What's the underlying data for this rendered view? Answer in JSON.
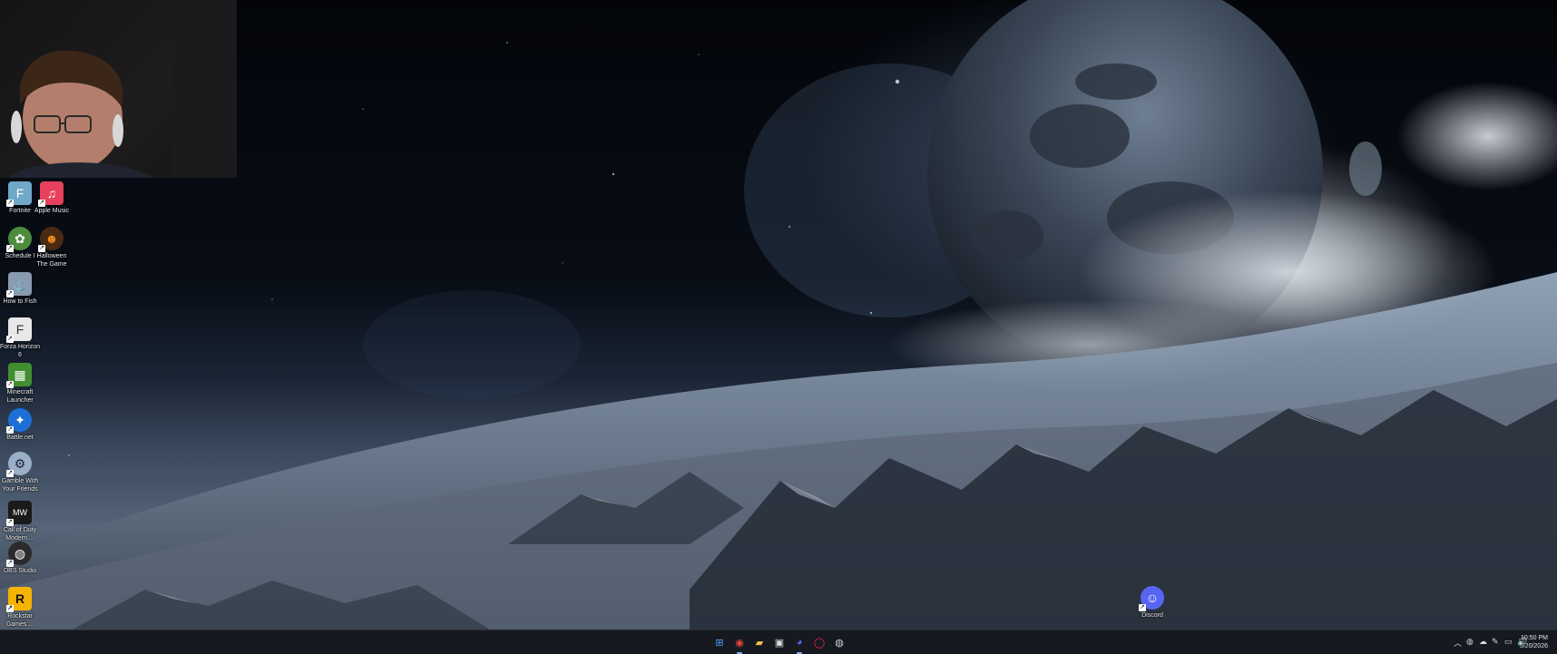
{
  "desktop": {
    "icons": [
      {
        "label": "Fortnite",
        "icon": "fortnite-icon",
        "color": "#6fa8c9"
      },
      {
        "label": "Apple Music",
        "icon": "apple-music-icon",
        "color": "#e6405d"
      },
      {
        "label": "Schedule I",
        "icon": "schedule-i-icon",
        "color": "#4c8c3c"
      },
      {
        "label": "Halloween The Game",
        "icon": "halloween-game-icon",
        "color": "#4a2a12"
      },
      {
        "label": "How to Fish",
        "icon": "how-to-fish-icon",
        "color": "#8a9bb0"
      },
      {
        "label": "Forza Horizon 6",
        "icon": "forza-icon",
        "color": "#e8e8e8"
      },
      {
        "label": "Minecraft Launcher",
        "icon": "minecraft-icon",
        "color": "#3f8f2f"
      },
      {
        "label": "Battle.net",
        "icon": "battlenet-icon",
        "color": "#1d6fd8"
      },
      {
        "label": "Gamble With Your Friends",
        "icon": "gamble-icon",
        "color": "#9ab0c8"
      },
      {
        "label": "Call of Duty Modern ...",
        "icon": "call-of-duty-icon",
        "color": "#1a1a1a"
      },
      {
        "label": "OBS Studio",
        "icon": "obs-icon",
        "color": "#2b2b2b"
      },
      {
        "label": "Rockstar Games ...",
        "icon": "rockstar-icon",
        "color": "#f5b400"
      },
      {
        "label": "Discord",
        "icon": "discord-icon",
        "color": "#5865f2"
      }
    ]
  },
  "taskbar": {
    "apps": [
      {
        "name": "start-button",
        "glyph": "⊞",
        "color": "#4aa3ff"
      },
      {
        "name": "chrome",
        "glyph": "◉",
        "color": "#e8453c"
      },
      {
        "name": "file-explorer",
        "glyph": "▰",
        "color": "#f3c24e"
      },
      {
        "name": "store",
        "glyph": "▣",
        "color": "#dcdcdc"
      },
      {
        "name": "discord",
        "glyph": "◕",
        "color": "#5865f2"
      },
      {
        "name": "opera-gx",
        "glyph": "◯",
        "color": "#fa1e4e"
      },
      {
        "name": "steam",
        "glyph": "◍",
        "color": "#c7d5e0"
      }
    ],
    "clock": {
      "time": "10:50 PM",
      "date": "5/20/2026"
    }
  }
}
